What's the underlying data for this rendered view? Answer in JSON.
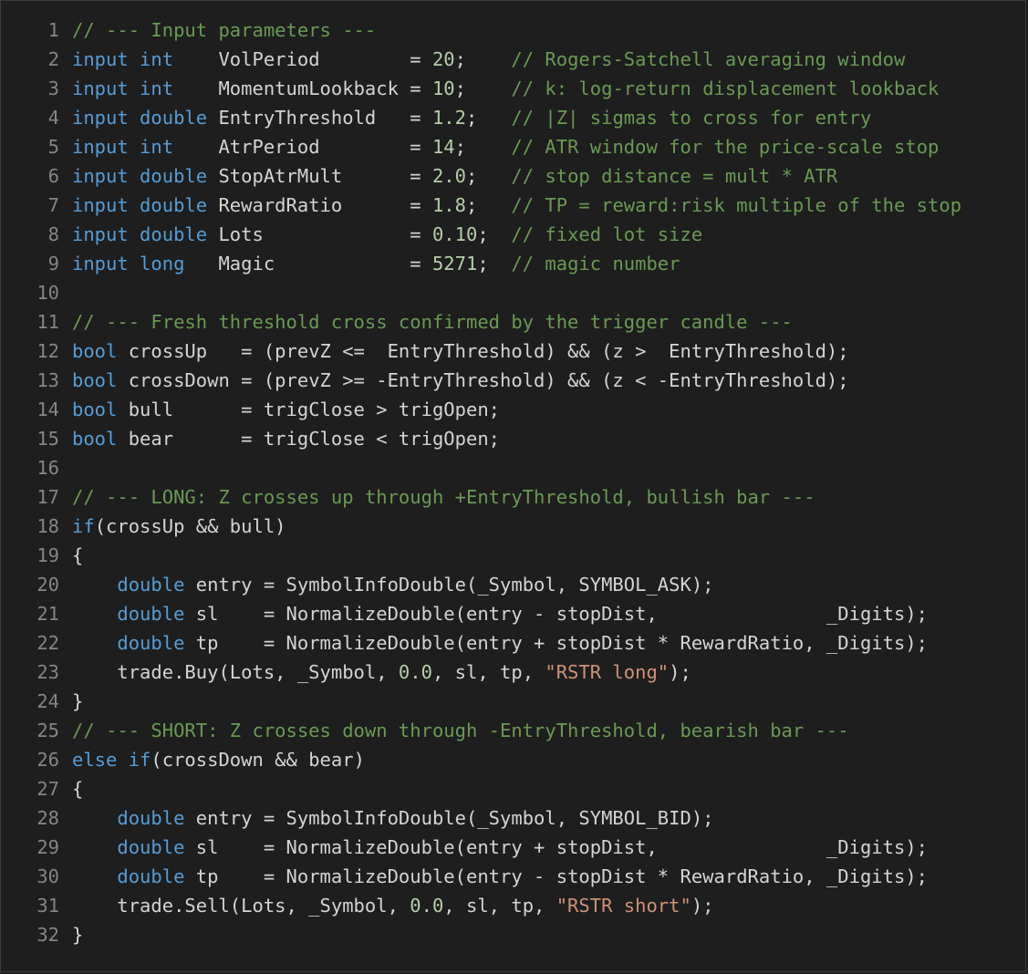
{
  "editor": {
    "lines": [
      {
        "n": "1",
        "tokens": [
          [
            "cm",
            "// --- Input parameters ---"
          ]
        ]
      },
      {
        "n": "2",
        "tokens": [
          [
            "kw",
            "input int"
          ],
          [
            "plain",
            "    VolPeriod        = "
          ],
          [
            "num",
            "20"
          ],
          [
            "plain",
            ";    "
          ],
          [
            "cm",
            "// Rogers-Satchell averaging window"
          ]
        ]
      },
      {
        "n": "3",
        "tokens": [
          [
            "kw",
            "input int"
          ],
          [
            "plain",
            "    MomentumLookback = "
          ],
          [
            "num",
            "10"
          ],
          [
            "plain",
            ";    "
          ],
          [
            "cm",
            "// k: log-return displacement lookback"
          ]
        ]
      },
      {
        "n": "4",
        "tokens": [
          [
            "kw",
            "input double"
          ],
          [
            "plain",
            " EntryThreshold   = "
          ],
          [
            "num",
            "1.2"
          ],
          [
            "plain",
            ";   "
          ],
          [
            "cm",
            "// |Z| sigmas to cross for entry"
          ]
        ]
      },
      {
        "n": "5",
        "tokens": [
          [
            "kw",
            "input int"
          ],
          [
            "plain",
            "    AtrPeriod        = "
          ],
          [
            "num",
            "14"
          ],
          [
            "plain",
            ";    "
          ],
          [
            "cm",
            "// ATR window for the price-scale stop"
          ]
        ]
      },
      {
        "n": "6",
        "tokens": [
          [
            "kw",
            "input double"
          ],
          [
            "plain",
            " StopAtrMult      = "
          ],
          [
            "num",
            "2.0"
          ],
          [
            "plain",
            ";   "
          ],
          [
            "cm",
            "// stop distance = mult * ATR"
          ]
        ]
      },
      {
        "n": "7",
        "tokens": [
          [
            "kw",
            "input double"
          ],
          [
            "plain",
            " RewardRatio      = "
          ],
          [
            "num",
            "1.8"
          ],
          [
            "plain",
            ";   "
          ],
          [
            "cm",
            "// TP = reward:risk multiple of the stop"
          ]
        ]
      },
      {
        "n": "8",
        "tokens": [
          [
            "kw",
            "input double"
          ],
          [
            "plain",
            " Lots             = "
          ],
          [
            "num",
            "0.10"
          ],
          [
            "plain",
            ";  "
          ],
          [
            "cm",
            "// fixed lot size"
          ]
        ]
      },
      {
        "n": "9",
        "tokens": [
          [
            "kw",
            "input long"
          ],
          [
            "plain",
            "   Magic            = "
          ],
          [
            "num",
            "5271"
          ],
          [
            "plain",
            ";  "
          ],
          [
            "cm",
            "// magic number"
          ]
        ]
      },
      {
        "n": "10",
        "tokens": []
      },
      {
        "n": "11",
        "tokens": [
          [
            "cm",
            "// --- Fresh threshold cross confirmed by the trigger candle ---"
          ]
        ]
      },
      {
        "n": "12",
        "tokens": [
          [
            "kw",
            "bool"
          ],
          [
            "plain",
            " crossUp   = (prevZ <=  EntryThreshold) && (z >  EntryThreshold);"
          ]
        ]
      },
      {
        "n": "13",
        "tokens": [
          [
            "kw",
            "bool"
          ],
          [
            "plain",
            " crossDown = (prevZ >= -EntryThreshold) && (z < -EntryThreshold);"
          ]
        ]
      },
      {
        "n": "14",
        "tokens": [
          [
            "kw",
            "bool"
          ],
          [
            "plain",
            " bull      = trigClose > trigOpen;"
          ]
        ]
      },
      {
        "n": "15",
        "tokens": [
          [
            "kw",
            "bool"
          ],
          [
            "plain",
            " bear      = trigClose < trigOpen;"
          ]
        ]
      },
      {
        "n": "16",
        "tokens": []
      },
      {
        "n": "17",
        "tokens": [
          [
            "cm",
            "// --- LONG: Z crosses up through +EntryThreshold, bullish bar ---"
          ]
        ]
      },
      {
        "n": "18",
        "tokens": [
          [
            "kw",
            "if"
          ],
          [
            "plain",
            "(crossUp && bull)"
          ]
        ]
      },
      {
        "n": "19",
        "tokens": [
          [
            "plain",
            "{"
          ]
        ]
      },
      {
        "n": "20",
        "tokens": [
          [
            "plain",
            "    "
          ],
          [
            "kw",
            "double"
          ],
          [
            "plain",
            " entry = SymbolInfoDouble(_Symbol, SYMBOL_ASK);"
          ]
        ]
      },
      {
        "n": "21",
        "tokens": [
          [
            "plain",
            "    "
          ],
          [
            "kw",
            "double"
          ],
          [
            "plain",
            " sl    = NormalizeDouble(entry - stopDist,               _Digits);"
          ]
        ]
      },
      {
        "n": "22",
        "tokens": [
          [
            "plain",
            "    "
          ],
          [
            "kw",
            "double"
          ],
          [
            "plain",
            " tp    = NormalizeDouble(entry + stopDist * RewardRatio, _Digits);"
          ]
        ]
      },
      {
        "n": "23",
        "tokens": [
          [
            "plain",
            "    trade.Buy(Lots, _Symbol, "
          ],
          [
            "num",
            "0.0"
          ],
          [
            "plain",
            ", sl, tp, "
          ],
          [
            "str",
            "\"RSTR long\""
          ],
          [
            "plain",
            ");"
          ]
        ]
      },
      {
        "n": "24",
        "tokens": [
          [
            "plain",
            "}"
          ]
        ]
      },
      {
        "n": "25",
        "tokens": [
          [
            "cm",
            "// --- SHORT: Z crosses down through -EntryThreshold, bearish bar ---"
          ]
        ]
      },
      {
        "n": "26",
        "tokens": [
          [
            "kw",
            "else if"
          ],
          [
            "plain",
            "(crossDown && bear)"
          ]
        ]
      },
      {
        "n": "27",
        "tokens": [
          [
            "plain",
            "{"
          ]
        ]
      },
      {
        "n": "28",
        "tokens": [
          [
            "plain",
            "    "
          ],
          [
            "kw",
            "double"
          ],
          [
            "plain",
            " entry = SymbolInfoDouble(_Symbol, SYMBOL_BID);"
          ]
        ]
      },
      {
        "n": "29",
        "tokens": [
          [
            "plain",
            "    "
          ],
          [
            "kw",
            "double"
          ],
          [
            "plain",
            " sl    = NormalizeDouble(entry + stopDist,               _Digits);"
          ]
        ]
      },
      {
        "n": "30",
        "tokens": [
          [
            "plain",
            "    "
          ],
          [
            "kw",
            "double"
          ],
          [
            "plain",
            " tp    = NormalizeDouble(entry - stopDist * RewardRatio, _Digits);"
          ]
        ]
      },
      {
        "n": "31",
        "tokens": [
          [
            "plain",
            "    trade.Sell(Lots, _Symbol, "
          ],
          [
            "num",
            "0.0"
          ],
          [
            "plain",
            ", sl, tp, "
          ],
          [
            "str",
            "\"RSTR short\""
          ],
          [
            "plain",
            ");"
          ]
        ]
      },
      {
        "n": "32",
        "tokens": [
          [
            "plain",
            "}"
          ]
        ]
      }
    ]
  },
  "colors": {
    "background": "#1e1e1e",
    "line_number": "#858585",
    "plain": "#d4d4d4",
    "keyword": "#569cd6",
    "comment": "#6a9955",
    "number": "#b5cea8",
    "string": "#ce9178"
  }
}
